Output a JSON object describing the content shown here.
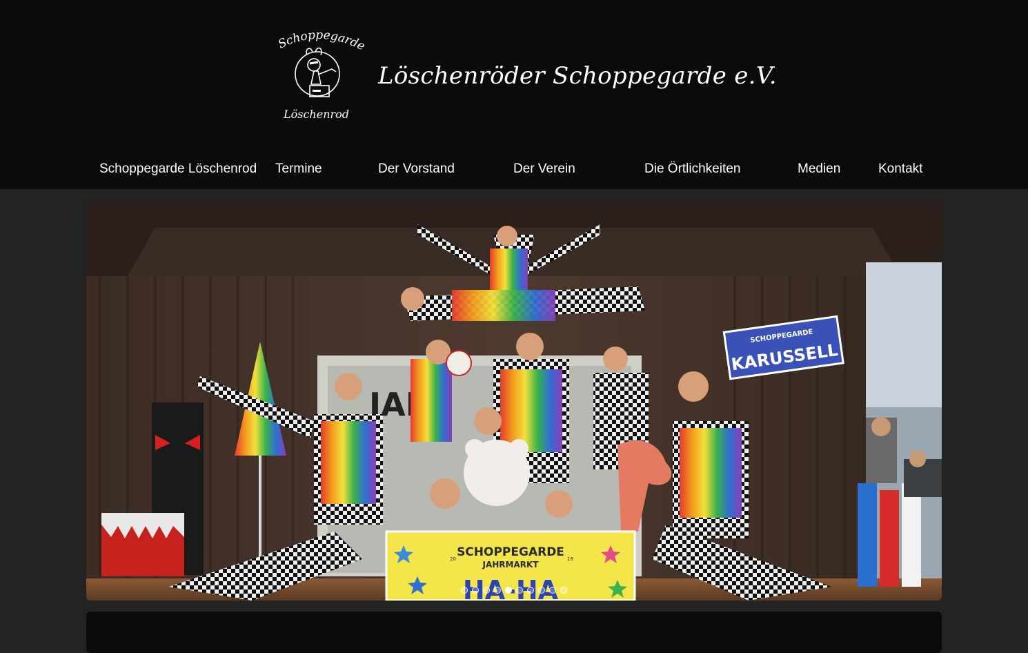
{
  "header": {
    "logo_top_text": "Schoppegarde",
    "logo_bottom_text": "Löschenrod",
    "site_title": "Löschenröder Schoppegarde e.V."
  },
  "nav": {
    "items": [
      {
        "label": "Schoppegarde Löschenrod"
      },
      {
        "label": "Termine"
      },
      {
        "label": "Der Vorstand"
      },
      {
        "label": "Der Verein"
      },
      {
        "label": "Die Örtlichkeiten"
      },
      {
        "label": "Medien"
      },
      {
        "label": "Kontakt"
      }
    ]
  },
  "slider": {
    "image_sign_left": "KARUSSELL",
    "image_sign_left_top": "SCHOPPEGARDE",
    "image_sign_left_sub": "JAHRMARKT",
    "image_banner_title": "SCHOPPEGARDE",
    "image_banner_year_left": "20",
    "image_banner_year_right": "16",
    "image_banner_sub": "JAHRMARKT",
    "image_banner_bottom": "HA-HA",
    "image_backdrop_text": "JAH",
    "dot_count": 10,
    "active_dot": 5
  },
  "colors": {
    "header_bg": "#0b0b0b",
    "page_bg": "#232323",
    "text": "#ffffff"
  }
}
